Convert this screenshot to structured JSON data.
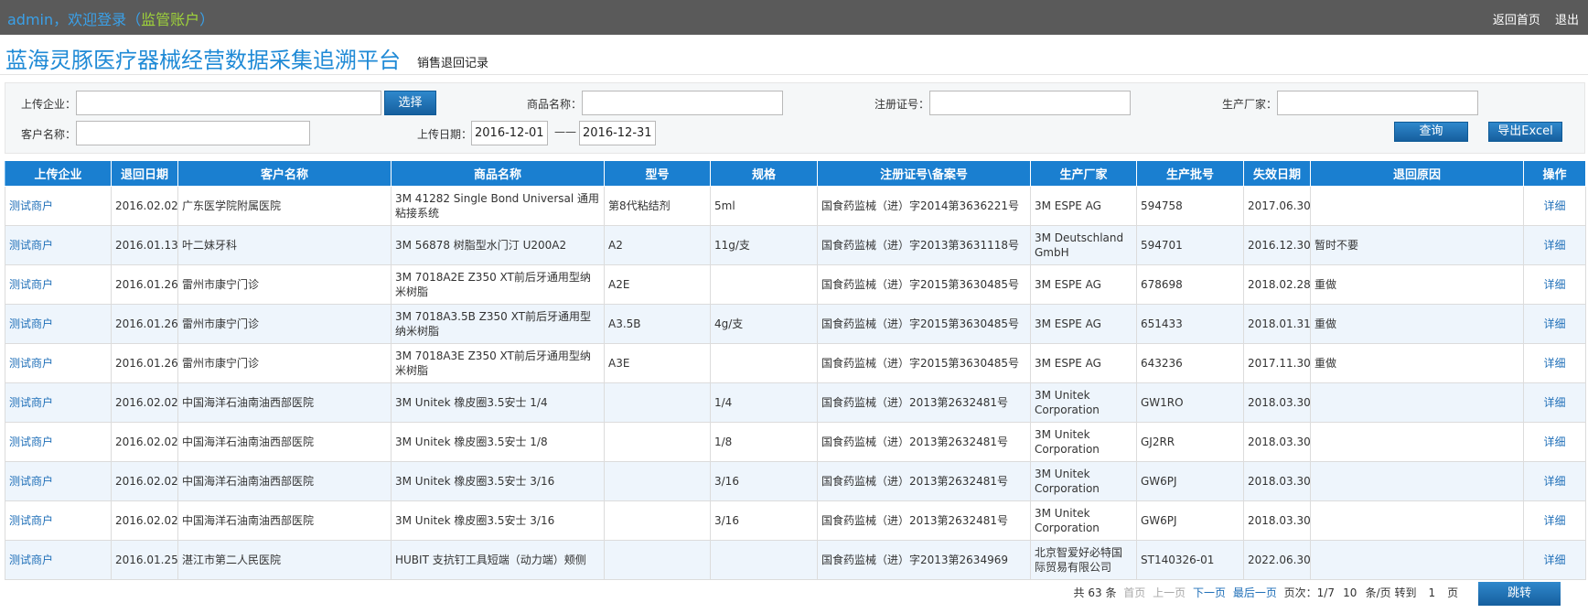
{
  "topbar": {
    "welcome_prefix": "admin，欢迎登录（",
    "role": "监管账户",
    "welcome_suffix": "）",
    "home_link": "返回首页",
    "logout_link": "退出"
  },
  "header": {
    "site_title": "蓝海灵豚医疗器械经营数据采集追溯平台",
    "page_subtitle": "销售退回记录"
  },
  "search": {
    "upload_company_label": "上传企业：",
    "upload_company_value": "",
    "select_button": "选择",
    "product_name_label": "商品名称：",
    "product_name_value": "",
    "reg_no_label": "注册证号：",
    "reg_no_value": "",
    "manufacturer_label": "生产厂家：",
    "manufacturer_value": "",
    "customer_label": "客户名称：",
    "customer_value": "",
    "upload_date_label": "上传日期：",
    "date_from": "2016-12-01",
    "date_sep": "——",
    "date_to": "2016-12-31",
    "query_button": "查询",
    "export_button": "导出Excel"
  },
  "table": {
    "columns": [
      "上传企业",
      "退回日期",
      "客户名称",
      "商品名称",
      "型号",
      "规格",
      "注册证号\\备案号",
      "生产厂家",
      "生产批号",
      "失效日期",
      "退回原因",
      "操作"
    ],
    "rows": [
      [
        "测试商户",
        "2016.02.02",
        "广东医学院附属医院",
        "3M 41282 Single Bond Universal 通用粘接系统",
        "第8代粘结剂",
        "5ml",
        "国食药监械（进）字2014第3636221号",
        "3M ESPE AG",
        "594758",
        "2017.06.30",
        "",
        "详细"
      ],
      [
        "测试商户",
        "2016.01.13",
        "叶二妹牙科",
        "3M 56878 树脂型水门汀 U200A2",
        "A2",
        "11g/支",
        "国食药监械（进）字2013第3631118号",
        "3M Deutschland GmbH",
        "594701",
        "2016.12.30",
        "暂时不要",
        "详细"
      ],
      [
        "测试商户",
        "2016.01.26",
        "雷州市康宁门诊",
        "3M 7018A2E Z350 XT前后牙通用型纳米树脂",
        "A2E",
        "",
        "国食药监械（进）字2015第3630485号",
        "3M ESPE AG",
        "678698",
        "2018.02.28",
        "重做",
        "详细"
      ],
      [
        "测试商户",
        "2016.01.26",
        "雷州市康宁门诊",
        "3M 7018A3.5B Z350 XT前后牙通用型纳米树脂",
        "A3.5B",
        "4g/支",
        "国食药监械（进）字2015第3630485号",
        "3M ESPE AG",
        "651433",
        "2018.01.31",
        "重做",
        "详细"
      ],
      [
        "测试商户",
        "2016.01.26",
        "雷州市康宁门诊",
        "3M 7018A3E Z350 XT前后牙通用型纳米树脂",
        "A3E",
        "",
        "国食药监械（进）字2015第3630485号",
        "3M ESPE AG",
        "643236",
        "2017.11.30",
        "重做",
        "详细"
      ],
      [
        "测试商户",
        "2016.02.02",
        "中国海洋石油南油西部医院",
        "3M Unitek 橡皮圈3.5安士 1/4",
        "",
        "1/4",
        "国食药监械（进）2013第2632481号",
        "3M Unitek Corporation",
        "GW1RO",
        "2018.03.30",
        "",
        "详细"
      ],
      [
        "测试商户",
        "2016.02.02",
        "中国海洋石油南油西部医院",
        "3M Unitek 橡皮圈3.5安士 1/8",
        "",
        "1/8",
        "国食药监械（进）2013第2632481号",
        "3M Unitek Corporation",
        "GJ2RR",
        "2018.03.30",
        "",
        "详细"
      ],
      [
        "测试商户",
        "2016.02.02",
        "中国海洋石油南油西部医院",
        "3M Unitek 橡皮圈3.5安士 3/16",
        "",
        "3/16",
        "国食药监械（进）2013第2632481号",
        "3M Unitek Corporation",
        "GW6PJ",
        "2018.03.30",
        "",
        "详细"
      ],
      [
        "测试商户",
        "2016.02.02",
        "中国海洋石油南油西部医院",
        "3M Unitek 橡皮圈3.5安士 3/16",
        "",
        "3/16",
        "国食药监械（进）2013第2632481号",
        "3M Unitek Corporation",
        "GW6PJ",
        "2018.03.30",
        "",
        "详细"
      ],
      [
        "测试商户",
        "2016.01.25",
        "湛江市第二人民医院",
        "HUBIT 支抗钉工具短端（动力端）颊侧",
        "",
        "",
        "国食药监械（进）字2013第2634969",
        "北京智爱好必特国际贸易有限公司",
        "ST140326-01",
        "2022.06.30",
        "",
        "详细"
      ]
    ]
  },
  "pager": {
    "total": "共 63 条",
    "first": "首页",
    "prev": "上一页",
    "next": "下一页",
    "last": "最后一页",
    "page_info": "页次：1/7",
    "page_size": "10",
    "per_page_label": "条/页 转到",
    "goto_page": "1",
    "page_unit": "页",
    "go_button": "跳转"
  }
}
